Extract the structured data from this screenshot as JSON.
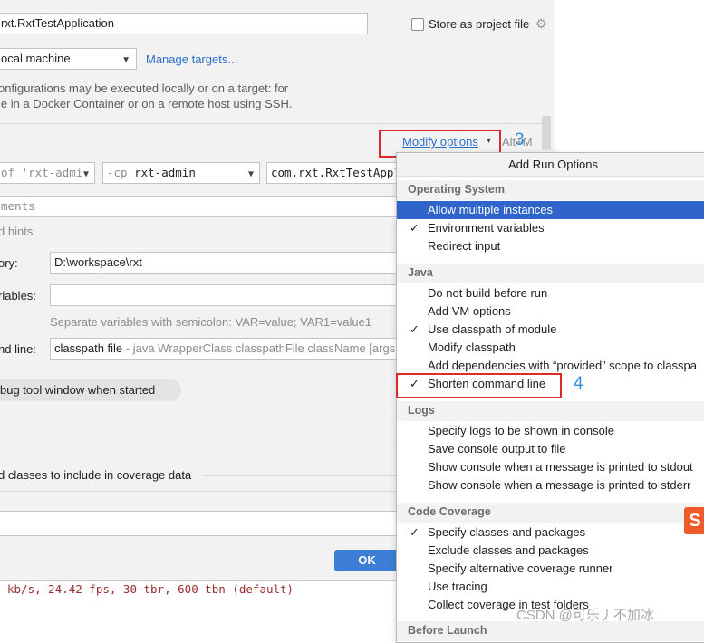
{
  "dialog": {
    "name_value": "rxt.RxtTestApplication",
    "store_label": "Store as project file",
    "run_on_value": "ocal machine",
    "manage_targets": "Manage targets...",
    "info_line1": "onfigurations may be executed locally or on a target: for",
    "info_line2": "le in a Docker Container or on a remote host using SSH.",
    "modify_options": "Modify options",
    "modify_shortcut": "Alt+M",
    "jdk_value": "of 'rxt-admi",
    "cp_flag": "-cp",
    "cp_value": "rxt-admin",
    "main_class": "com.rxt.RxtTestAppli",
    "program_args_placeholder": "ments",
    "hints_label": "d hints",
    "workdir_label": "ory:",
    "workdir_value": "D:\\workspace\\rxt",
    "env_label": "riables:",
    "env_hint": "Separate variables with semicolon: VAR=value; VAR1=value1",
    "shorten_label": "nd line:",
    "shorten_value": "classpath file",
    "shorten_hint": " - java WrapperClass classpathFile className [args",
    "debug_chip": "bug tool window when started",
    "coverage_label": "d classes to include in coverage data",
    "ok_button": "OK"
  },
  "console_text": "kb/s, 24.42 fps, 30 tbr, 600 tbn (default)",
  "menu": {
    "title": "Add Run Options",
    "sections": [
      {
        "title": "Operating System",
        "items": [
          {
            "label": "Allow multiple instances",
            "checked": false,
            "selected": true
          },
          {
            "label": "Environment variables",
            "checked": true
          },
          {
            "label": "Redirect input",
            "checked": false
          }
        ]
      },
      {
        "title": "Java",
        "items": [
          {
            "label": "Do not build before run",
            "checked": false
          },
          {
            "label": "Add VM options",
            "checked": false
          },
          {
            "label": "Use classpath of module",
            "checked": true
          },
          {
            "label": "Modify classpath",
            "checked": false
          },
          {
            "label": "Add dependencies with “provided” scope to classpa",
            "checked": false
          },
          {
            "label": "Shorten command line",
            "checked": true
          }
        ]
      },
      {
        "title": "Logs",
        "items": [
          {
            "label": "Specify logs to be shown in console",
            "checked": false
          },
          {
            "label": "Save console output to file",
            "checked": false
          },
          {
            "label": "Show console when a message is printed to stdout",
            "checked": false
          },
          {
            "label": "Show console when a message is printed to stderr",
            "checked": false
          }
        ]
      },
      {
        "title": "Code Coverage",
        "items": [
          {
            "label": "Specify classes and packages",
            "checked": true
          },
          {
            "label": "Exclude classes and packages",
            "checked": false
          },
          {
            "label": "Specify alternative coverage runner",
            "checked": false
          },
          {
            "label": "Use tracing",
            "checked": false
          },
          {
            "label": "Collect coverage in test folders",
            "checked": false
          }
        ]
      },
      {
        "title": "Before Launch",
        "items": []
      }
    ]
  },
  "annotations": {
    "step3": "3",
    "step4": "4"
  },
  "badge_letter": "S",
  "watermark": "CSDN @可乐丿不加冰",
  "colors": {
    "selection": "#2f65ca",
    "annotation_box": "#e02a2a",
    "annotation_number": "#2a8bd8",
    "link": "#2a6fc9"
  }
}
